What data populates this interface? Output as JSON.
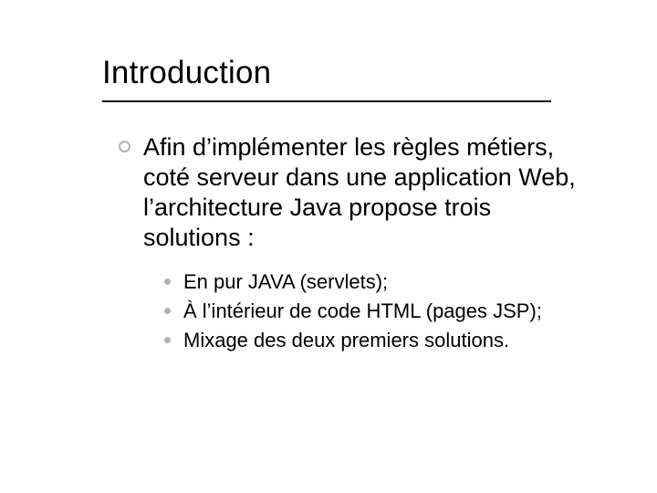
{
  "title": "Introduction",
  "main": {
    "bullet": "Afin d’implémenter les règles métiers, coté serveur dans une application Web, l’architecture Java propose trois solutions :",
    "subitems": [
      "En pur JAVA (servlets);",
      "À l’intérieur de code HTML (pages JSP);",
      "Mixage des deux premiers solutions."
    ]
  }
}
